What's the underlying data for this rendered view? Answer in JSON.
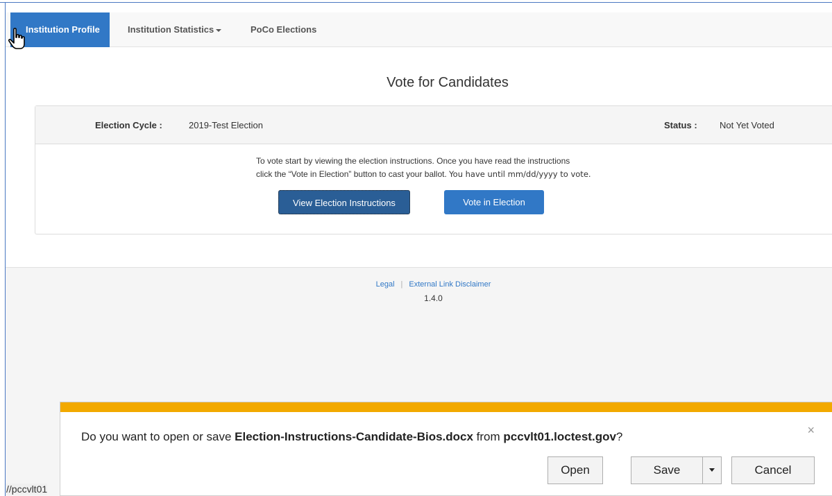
{
  "nav": {
    "items": [
      {
        "label": "Institution Profile"
      },
      {
        "label": "Institution Statistics"
      },
      {
        "label": "PoCo Elections"
      }
    ]
  },
  "main": {
    "title": "Vote for Candidates",
    "panel": {
      "election_cycle_label": "Election Cycle :",
      "election_cycle_value": "2019-Test Election",
      "status_label": "Status :",
      "status_value": "Not Yet Voted",
      "instructions_line1": "To vote start by viewing the election instructions. Once you have read the instructions",
      "instructions_line2_a": "click the “Vote in Election” button to cast your ballot.",
      "instructions_line2_b": "You have until mm/dd/yyyy to vote.",
      "view_instructions_label": "View Election Instructions",
      "vote_label": "Vote in Election"
    }
  },
  "footer": {
    "legal": "Legal",
    "separator": "|",
    "disclaimer": "External Link Disclaimer",
    "version": "1.4.0"
  },
  "status_bar": {
    "url_fragment": "//pccvlt01"
  },
  "download_bar": {
    "prefix": "Do you want to open or save ",
    "filename": "Election-Instructions-Candidate-Bios.docx",
    "middle": " from ",
    "host": "pccvlt01.loctest.gov",
    "suffix": "?",
    "close": "×",
    "open_label": "Open",
    "save_label": "Save",
    "cancel_label": "Cancel"
  }
}
